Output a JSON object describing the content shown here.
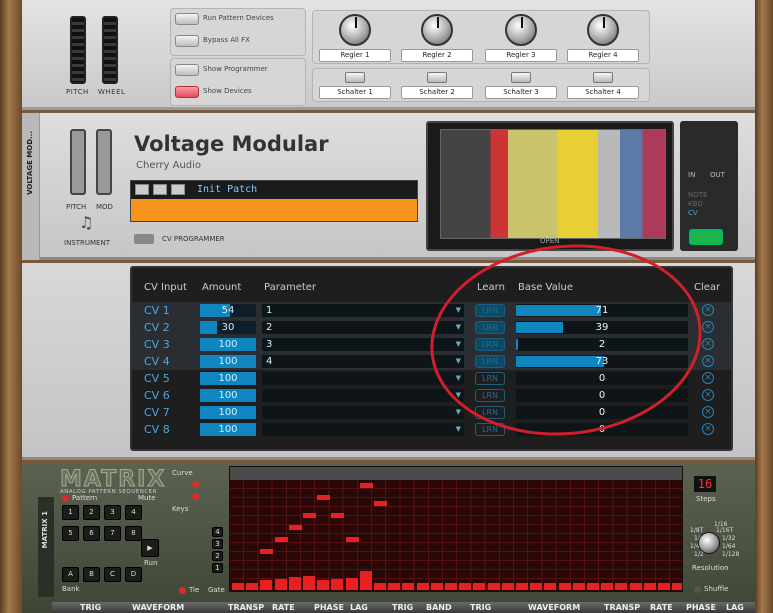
{
  "top": {
    "pitch_label": "PITCH",
    "wheel_label": "WHEEL",
    "buttons": [
      "Run Pattern Devices",
      "Bypass All FX",
      "Show Programmer",
      "Show Devices"
    ],
    "knobs": [
      "Regler 1",
      "Regler 2",
      "Regler 3",
      "Regler 4"
    ],
    "switches": [
      "Schalter 1",
      "Schalter 2",
      "Schalter 3",
      "Schalter 4"
    ]
  },
  "vm": {
    "side_label": "VOLTAGE MOD...",
    "title": "Voltage Modular",
    "subtitle": "Cherry Audio",
    "patch_name": "Init Patch",
    "pitch_label": "PITCH",
    "mod_label": "MOD",
    "instrument_label": "INSTRUMENT",
    "cv_programmer_label": "CV PROGRAMMER",
    "open_label": "OPEN",
    "in_label": "IN",
    "out_label": "OUT",
    "io_options": [
      "NOTE",
      "KBD",
      "CV"
    ]
  },
  "cvp": {
    "headers": {
      "cv_input": "CV Input",
      "amount": "Amount",
      "parameter": "Parameter",
      "learn": "Learn",
      "base_value": "Base Value",
      "clear": "Clear"
    },
    "learn_label": "LRN",
    "rows": [
      {
        "cv": "CV 1",
        "amount": "54",
        "amount_pct": 0.54,
        "param": "1",
        "base": "71",
        "base_pct": 0.71
      },
      {
        "cv": "CV 2",
        "amount": "30",
        "amount_pct": 0.3,
        "param": "2",
        "base": "39",
        "base_pct": 0.39
      },
      {
        "cv": "CV 3",
        "amount": "100",
        "amount_pct": 1.0,
        "param": "3",
        "base": "2",
        "base_pct": 0.02
      },
      {
        "cv": "CV 4",
        "amount": "100",
        "amount_pct": 1.0,
        "param": "4",
        "base": "73",
        "base_pct": 0.73
      },
      {
        "cv": "CV 5",
        "amount": "100",
        "amount_pct": 1.0,
        "param": "",
        "base": "0",
        "base_pct": 0
      },
      {
        "cv": "CV 6",
        "amount": "100",
        "amount_pct": 1.0,
        "param": "",
        "base": "0",
        "base_pct": 0
      },
      {
        "cv": "CV 7",
        "amount": "100",
        "amount_pct": 1.0,
        "param": "",
        "base": "0",
        "base_pct": 0
      },
      {
        "cv": "CV 8",
        "amount": "100",
        "amount_pct": 1.0,
        "param": "",
        "base": "0",
        "base_pct": 0
      }
    ]
  },
  "matrix": {
    "side_label": "MATRIX 1",
    "logo": "MATRIX",
    "subtitle": "ANALOG PATTERN SEQUENCER",
    "pattern_label": "Pattern",
    "mute_label": "Mute",
    "bank_label": "Bank",
    "run_label": "Run",
    "curve_label": "Curve",
    "keys_label": "Keys",
    "gate_label": "Gate",
    "tie_label": "Tie",
    "steps_label": "Steps",
    "steps_value": "16",
    "resolution_label": "Resolution",
    "shuffle_label": "Shuffle",
    "pad_numbers": [
      "1",
      "2",
      "3",
      "4",
      "5",
      "6",
      "7",
      "8"
    ],
    "bank_letters": [
      "A",
      "B",
      "C",
      "D"
    ],
    "octave_labels": [
      "4",
      "3",
      "2",
      "1"
    ],
    "resolution_options": [
      "1/16",
      "1/8T",
      "1/16T",
      "1/8",
      "1/32",
      "1/4",
      "1/64",
      "1/2",
      "1/128"
    ],
    "notes": [
      0,
      0,
      3,
      5,
      7,
      9,
      12,
      9,
      5,
      14,
      11,
      0,
      0,
      0,
      0,
      0
    ],
    "gates": [
      0.35,
      0.35,
      0.5,
      0.55,
      0.65,
      0.7,
      0.5,
      0.55,
      0.6,
      0.95,
      0.35,
      0.35,
      0.35,
      0.35,
      0.35,
      0.35,
      0.35,
      0.35,
      0.35,
      0.35,
      0.35,
      0.35,
      0.35,
      0.35,
      0.35,
      0.35,
      0.35,
      0.35,
      0.35,
      0.35,
      0.35,
      0.35
    ],
    "bottom_labels": [
      "TRIG",
      "WAVEFORM",
      "TRANSP",
      "RATE",
      "PHASE",
      "LAG",
      "TRIG",
      "BAND",
      "TRIG",
      "WAVEFORM",
      "TRANSP",
      "RATE",
      "PHASE",
      "LAG"
    ]
  },
  "colors": {
    "accent_blue": "#0f86bf",
    "patch_orange": "#f7941d",
    "annotation_red": "#d21f2a",
    "power_green": "#1fb54a"
  }
}
